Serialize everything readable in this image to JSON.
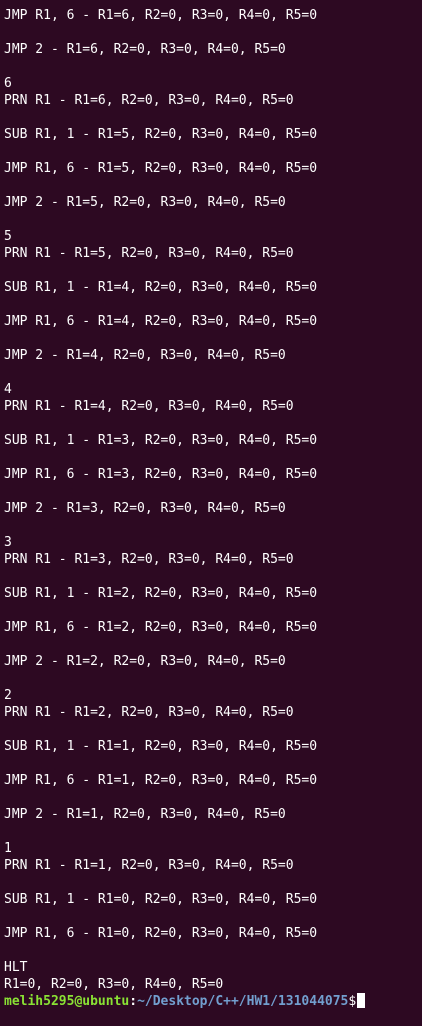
{
  "terminal": {
    "lines": [
      "JMP R1, 6 - R1=6, R2=0, R3=0, R4=0, R5=0",
      "",
      "JMP 2 - R1=6, R2=0, R3=0, R4=0, R5=0",
      "",
      "6",
      "PRN R1 - R1=6, R2=0, R3=0, R4=0, R5=0",
      "",
      "SUB R1, 1 - R1=5, R2=0, R3=0, R4=0, R5=0",
      "",
      "JMP R1, 6 - R1=5, R2=0, R3=0, R4=0, R5=0",
      "",
      "JMP 2 - R1=5, R2=0, R3=0, R4=0, R5=0",
      "",
      "5",
      "PRN R1 - R1=5, R2=0, R3=0, R4=0, R5=0",
      "",
      "SUB R1, 1 - R1=4, R2=0, R3=0, R4=0, R5=0",
      "",
      "JMP R1, 6 - R1=4, R2=0, R3=0, R4=0, R5=0",
      "",
      "JMP 2 - R1=4, R2=0, R3=0, R4=0, R5=0",
      "",
      "4",
      "PRN R1 - R1=4, R2=0, R3=0, R4=0, R5=0",
      "",
      "SUB R1, 1 - R1=3, R2=0, R3=0, R4=0, R5=0",
      "",
      "JMP R1, 6 - R1=3, R2=0, R3=0, R4=0, R5=0",
      "",
      "JMP 2 - R1=3, R2=0, R3=0, R4=0, R5=0",
      "",
      "3",
      "PRN R1 - R1=3, R2=0, R3=0, R4=0, R5=0",
      "",
      "SUB R1, 1 - R1=2, R2=0, R3=0, R4=0, R5=0",
      "",
      "JMP R1, 6 - R1=2, R2=0, R3=0, R4=0, R5=0",
      "",
      "JMP 2 - R1=2, R2=0, R3=0, R4=0, R5=0",
      "",
      "2",
      "PRN R1 - R1=2, R2=0, R3=0, R4=0, R5=0",
      "",
      "SUB R1, 1 - R1=1, R2=0, R3=0, R4=0, R5=0",
      "",
      "JMP R1, 6 - R1=1, R2=0, R3=0, R4=0, R5=0",
      "",
      "JMP 2 - R1=1, R2=0, R3=0, R4=0, R5=0",
      "",
      "1",
      "PRN R1 - R1=1, R2=0, R3=0, R4=0, R5=0",
      "",
      "SUB R1, 1 - R1=0, R2=0, R3=0, R4=0, R5=0",
      "",
      "JMP R1, 6 - R1=0, R2=0, R3=0, R4=0, R5=0",
      "",
      "HLT",
      "R1=0, R2=0, R3=0, R4=0, R5=0"
    ],
    "prompt": {
      "user_host": "melih5295@ubuntu",
      "separator": ":",
      "path": "~/Desktop/C++/HW1/131044075",
      "symbol": "$"
    }
  },
  "colors": {
    "background": "#2d0922",
    "text": "#ffffff",
    "prompt_user": "#8ae234",
    "prompt_path": "#729fcf"
  }
}
